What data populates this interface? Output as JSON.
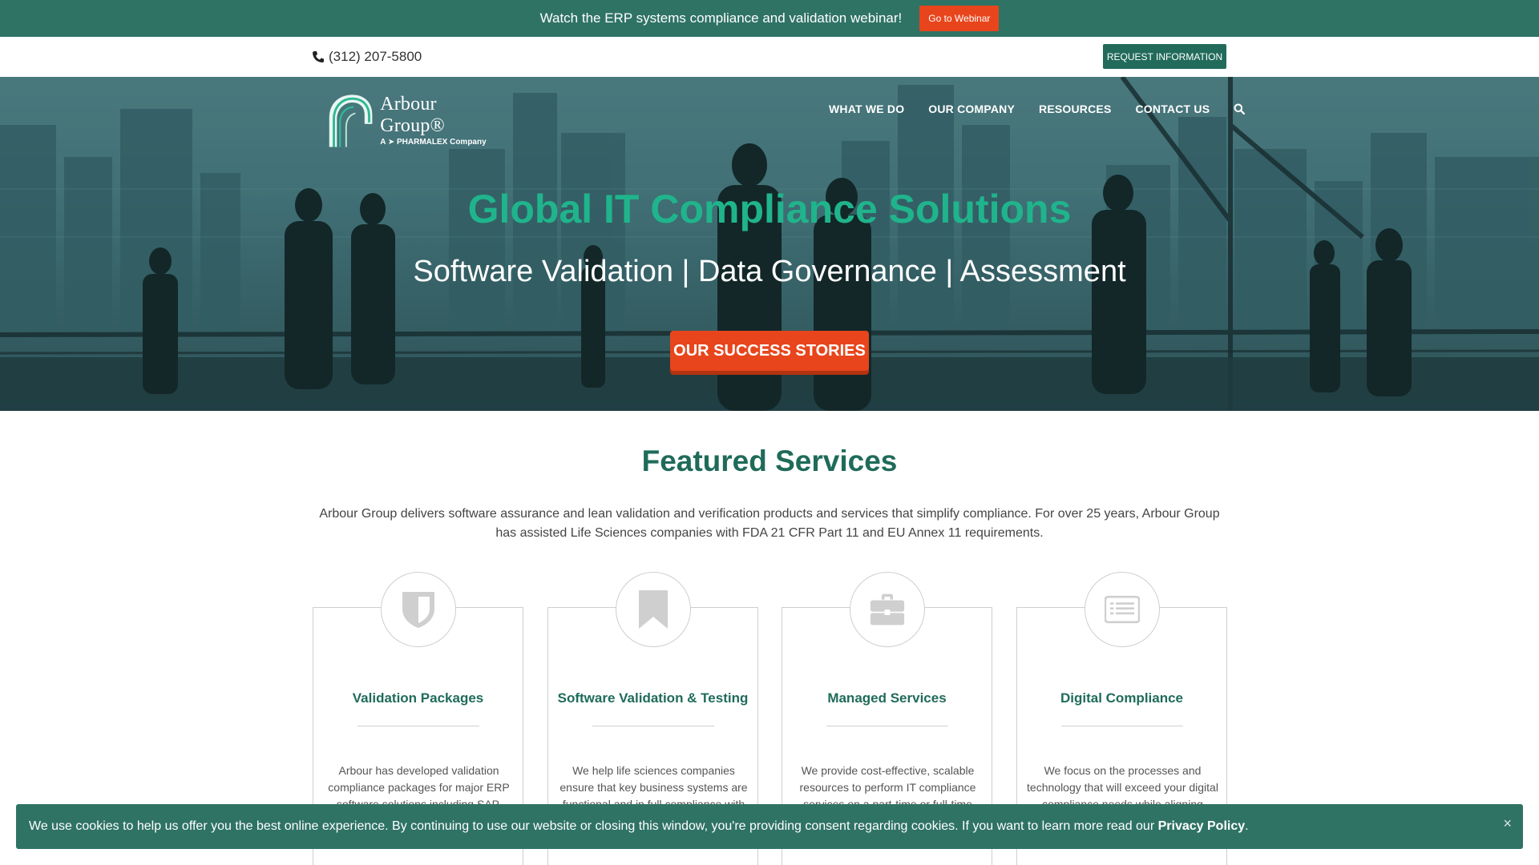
{
  "announcement": {
    "text": "Watch the ERP systems compliance and validation webinar!",
    "button": "Go to Webinar"
  },
  "utility": {
    "phone": "(312) 207-5800",
    "request_button": "REQUEST INFORMATION"
  },
  "logo": {
    "name": "Arbour Group®",
    "sub": "A ➤ PHARMALEX Company"
  },
  "nav": {
    "items": [
      "WHAT WE DO",
      "OUR COMPANY",
      "RESOURCES",
      "CONTACT US"
    ],
    "search_icon": "search-icon"
  },
  "hero": {
    "title": "Global IT Compliance Solutions",
    "subtitle": "Software Validation | Data Governance | Assessment",
    "cta": "OUR SUCCESS STORIES"
  },
  "featured": {
    "title": "Featured Services",
    "description": "Arbour Group delivers software assurance and lean validation and verification products and services that simplify compliance. For over 25 years, Arbour Group has assisted Life Sciences companies with FDA 21 CFR Part 11 and EU Annex 11 requirements.",
    "cards": [
      {
        "icon": "shield-icon",
        "title": "Validation Packages",
        "text": "Arbour has developed validation compliance packages for major ERP software solutions including SAP, Oracle"
      },
      {
        "icon": "bookmark-icon",
        "title": "Software Validation & Testing",
        "text": "We help life sciences companies ensure that key business systems are functional and in full compliance with applicable"
      },
      {
        "icon": "briefcase-icon",
        "title": "Managed Services",
        "text": "We provide cost-effective, scalable resources to perform IT compliance services on a part-time or full-time basis"
      },
      {
        "icon": "list-icon",
        "title": "Digital Compliance",
        "text": "We focus on the processes and technology that will exceed your digital compliance needs while aligning"
      }
    ]
  },
  "cookie": {
    "text": "We use cookies to help us offer you the best online experience. By continuing to use our website or closing this window, you're providing consent regarding cookies. If you want to learn more read our ",
    "link": "Privacy Policy",
    "suffix": ".",
    "close": "×"
  },
  "colors": {
    "brand_green": "#2f7365",
    "accent_orange": "#e8451c",
    "title_green": "#20b48c",
    "heading_green": "#1f6b5a"
  }
}
